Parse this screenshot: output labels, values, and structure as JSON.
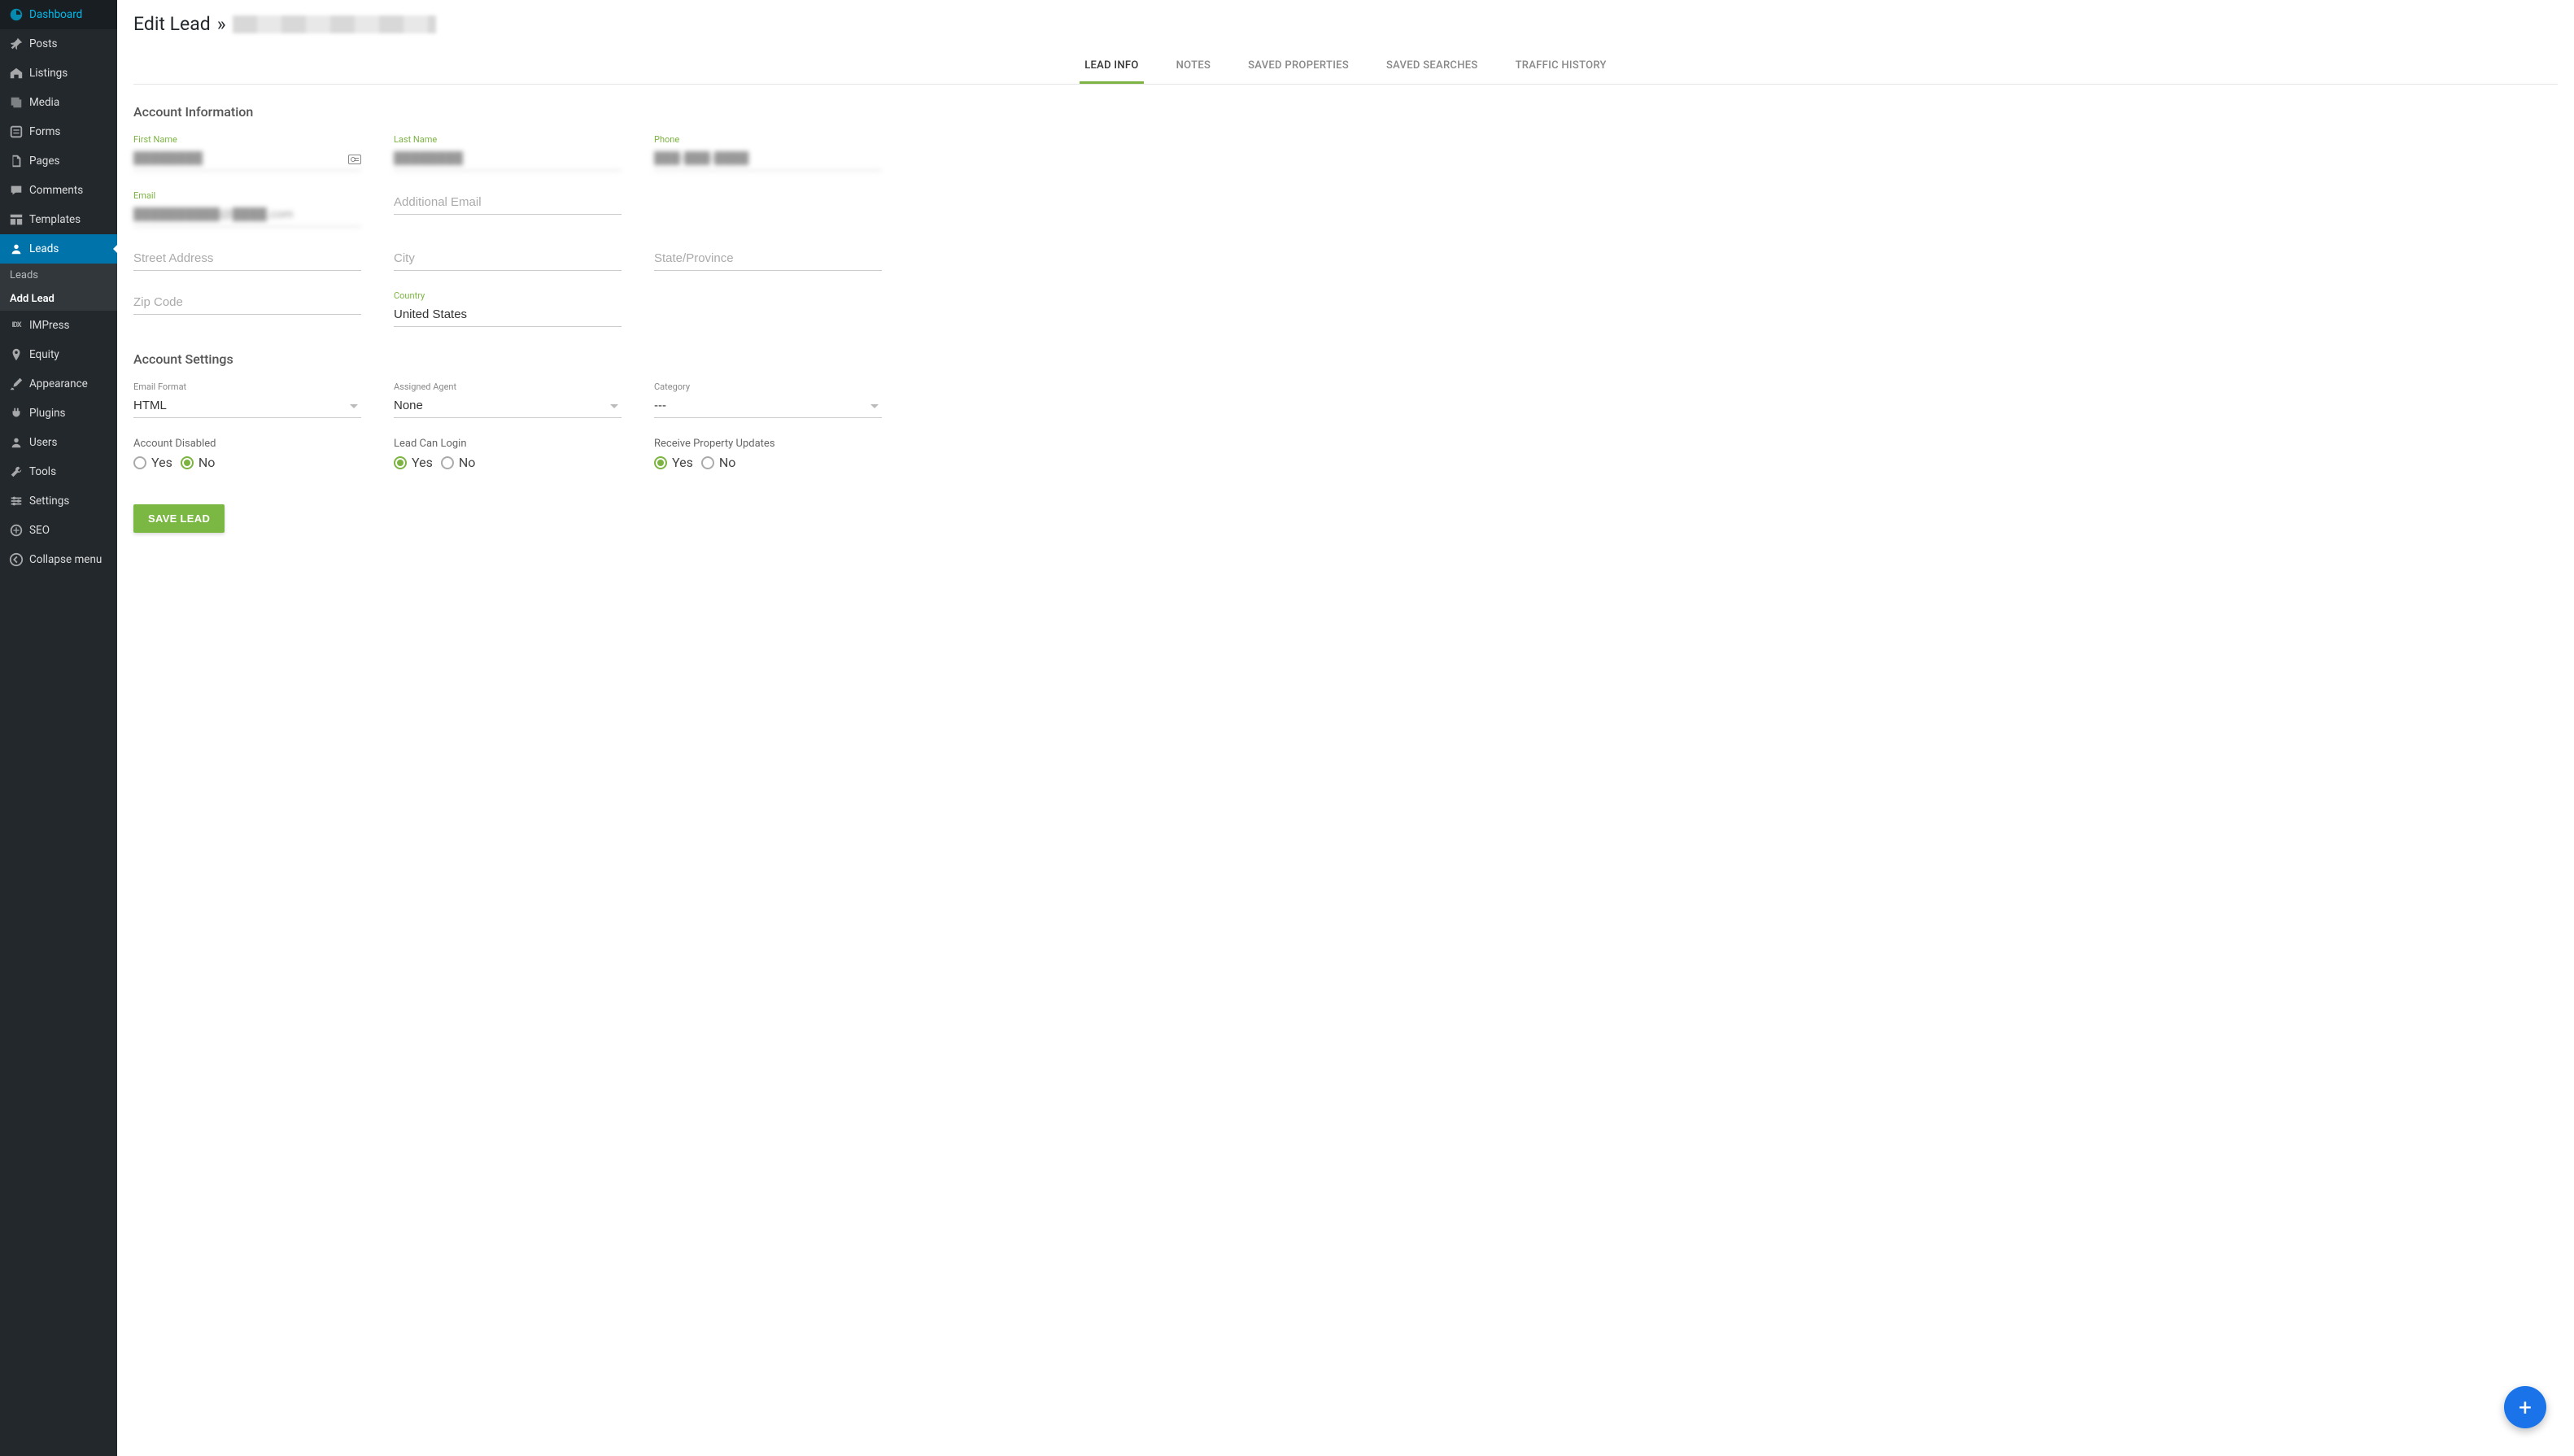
{
  "sidebar": {
    "items": [
      {
        "label": "Dashboard",
        "icon": "dashboard"
      },
      {
        "label": "Posts",
        "icon": "pin"
      },
      {
        "label": "Listings",
        "icon": "home"
      },
      {
        "label": "Media",
        "icon": "media"
      },
      {
        "label": "Forms",
        "icon": "forms"
      },
      {
        "label": "Pages",
        "icon": "pages"
      },
      {
        "label": "Comments",
        "icon": "comment"
      },
      {
        "label": "Templates",
        "icon": "templates"
      },
      {
        "label": "Leads",
        "icon": "user",
        "active": true
      },
      {
        "label": "IMPress",
        "icon": "idx"
      },
      {
        "label": "Equity",
        "icon": "marker"
      },
      {
        "label": "Appearance",
        "icon": "brush"
      },
      {
        "label": "Plugins",
        "icon": "plug"
      },
      {
        "label": "Users",
        "icon": "users"
      },
      {
        "label": "Tools",
        "icon": "tools"
      },
      {
        "label": "Settings",
        "icon": "settings"
      },
      {
        "label": "SEO",
        "icon": "seo"
      },
      {
        "label": "Collapse menu",
        "icon": "collapse"
      }
    ],
    "submenu": {
      "parent": "Leads",
      "items": [
        {
          "label": "Leads"
        },
        {
          "label": "Add Lead",
          "bold": true
        }
      ]
    }
  },
  "header": {
    "title_prefix": "Edit Lead",
    "separator": "»"
  },
  "tabs": [
    {
      "label": "LEAD INFO",
      "active": true
    },
    {
      "label": "NOTES"
    },
    {
      "label": "SAVED PROPERTIES"
    },
    {
      "label": "SAVED SEARCHES"
    },
    {
      "label": "TRAFFIC HISTORY"
    }
  ],
  "sections": {
    "account_info": {
      "title": "Account Information",
      "fields": {
        "first_name": {
          "label": "First Name",
          "value": "████████"
        },
        "last_name": {
          "label": "Last Name",
          "value": "████████"
        },
        "phone": {
          "label": "Phone",
          "value": "███-███-████"
        },
        "email": {
          "label": "Email",
          "value": "██████████@████.com"
        },
        "additional_email": {
          "placeholder": "Additional Email",
          "value": ""
        },
        "street": {
          "placeholder": "Street Address",
          "value": ""
        },
        "city": {
          "placeholder": "City",
          "value": ""
        },
        "state": {
          "placeholder": "State/Province",
          "value": ""
        },
        "zip": {
          "placeholder": "Zip Code",
          "value": ""
        },
        "country": {
          "label": "Country",
          "value": "United States"
        }
      }
    },
    "account_settings": {
      "title": "Account Settings",
      "fields": {
        "email_format": {
          "label": "Email Format",
          "value": "HTML"
        },
        "assigned_agent": {
          "label": "Assigned Agent",
          "value": "None"
        },
        "category": {
          "label": "Category",
          "value": "---"
        },
        "account_disabled": {
          "label": "Account Disabled",
          "selected": "No",
          "options": {
            "yes": "Yes",
            "no": "No"
          }
        },
        "lead_can_login": {
          "label": "Lead Can Login",
          "selected": "Yes",
          "options": {
            "yes": "Yes",
            "no": "No"
          }
        },
        "receive_updates": {
          "label": "Receive Property Updates",
          "selected": "Yes",
          "options": {
            "yes": "Yes",
            "no": "No"
          }
        }
      }
    }
  },
  "buttons": {
    "save": "SAVE LEAD"
  },
  "fab": {
    "label": "+"
  }
}
